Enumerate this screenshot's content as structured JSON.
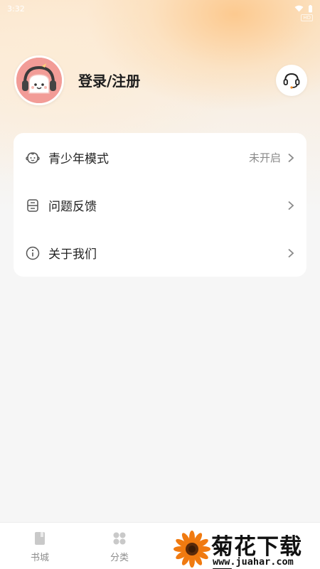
{
  "status_bar": {
    "time": "3:32",
    "hd_label": "HD"
  },
  "profile": {
    "login_label": "登录/注册"
  },
  "menu": [
    {
      "label": "青少年模式",
      "value": "未开启",
      "icon": "baby-face-icon"
    },
    {
      "label": "问题反馈",
      "value": "",
      "icon": "feedback-icon"
    },
    {
      "label": "关于我们",
      "value": "",
      "icon": "info-icon"
    }
  ],
  "bottom_nav": [
    {
      "label": "书城",
      "icon": "book-icon"
    },
    {
      "label": "分类",
      "icon": "category-icon"
    }
  ],
  "watermark": {
    "title": "菊花下载网",
    "url": "www.juahar.com"
  },
  "colors": {
    "accent": "#f29c97",
    "background": "#f6f6f6",
    "muted": "#8a8a8a"
  }
}
